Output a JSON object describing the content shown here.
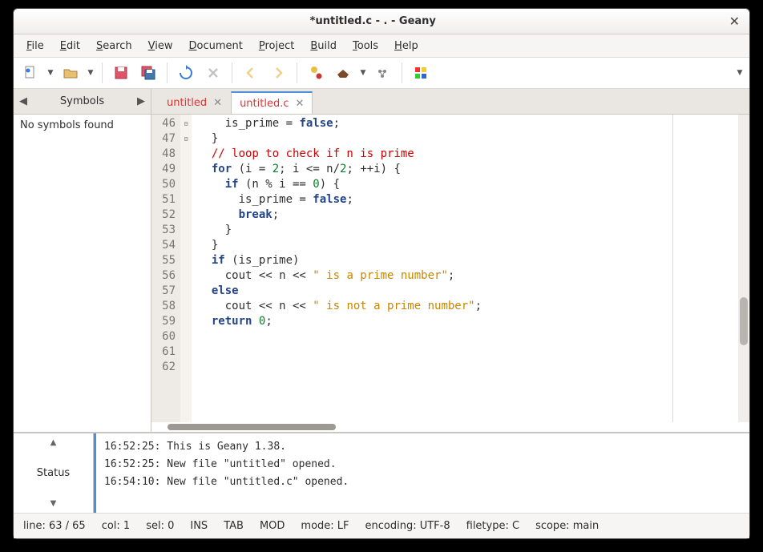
{
  "window": {
    "title": "*untitled.c - . - Geany"
  },
  "menu": [
    "File",
    "Edit",
    "Search",
    "View",
    "Document",
    "Project",
    "Build",
    "Tools",
    "Help"
  ],
  "sidebar": {
    "tab_label": "Symbols",
    "body": "No symbols found"
  },
  "tabs": [
    {
      "label": "untitled",
      "active": false
    },
    {
      "label": "untitled.c",
      "active": true
    }
  ],
  "code": {
    "first_line": 46,
    "lines": [
      {
        "n": 46,
        "fold": "",
        "tokens": [
          [
            "    is_prime = ",
            "op"
          ],
          [
            "false",
            "kw"
          ],
          [
            ";",
            "op"
          ]
        ]
      },
      {
        "n": 47,
        "fold": "",
        "tokens": [
          [
            "  }",
            "op"
          ]
        ]
      },
      {
        "n": 48,
        "fold": "",
        "tokens": [
          [
            "",
            "op"
          ]
        ]
      },
      {
        "n": 49,
        "fold": "",
        "tokens": [
          [
            "  ",
            "op"
          ],
          [
            "// loop to check if n is prime",
            "cmt"
          ]
        ]
      },
      {
        "n": 50,
        "fold": "⊟",
        "tokens": [
          [
            "  ",
            "op"
          ],
          [
            "for",
            "kw"
          ],
          [
            " (i = ",
            "op"
          ],
          [
            "2",
            "num"
          ],
          [
            "; i <= n/",
            "op"
          ],
          [
            "2",
            "num"
          ],
          [
            "; ++i) {",
            "op"
          ]
        ]
      },
      {
        "n": 51,
        "fold": "⊟",
        "tokens": [
          [
            "    ",
            "op"
          ],
          [
            "if",
            "kw"
          ],
          [
            " (n % i == ",
            "op"
          ],
          [
            "0",
            "num"
          ],
          [
            ") {",
            "op"
          ]
        ]
      },
      {
        "n": 52,
        "fold": "",
        "tokens": [
          [
            "      is_prime = ",
            "op"
          ],
          [
            "false",
            "kw"
          ],
          [
            ";",
            "op"
          ]
        ]
      },
      {
        "n": 53,
        "fold": "",
        "tokens": [
          [
            "      ",
            "op"
          ],
          [
            "break",
            "kw"
          ],
          [
            ";",
            "op"
          ]
        ]
      },
      {
        "n": 54,
        "fold": "",
        "tokens": [
          [
            "    }",
            "op"
          ]
        ]
      },
      {
        "n": 55,
        "fold": "",
        "tokens": [
          [
            "  }",
            "op"
          ]
        ]
      },
      {
        "n": 56,
        "fold": "",
        "tokens": [
          [
            "",
            "op"
          ]
        ]
      },
      {
        "n": 57,
        "fold": "",
        "tokens": [
          [
            "  ",
            "op"
          ],
          [
            "if",
            "kw"
          ],
          [
            " (is_prime)",
            "op"
          ]
        ]
      },
      {
        "n": 58,
        "fold": "",
        "tokens": [
          [
            "    cout << n << ",
            "op"
          ],
          [
            "\" is a prime number\"",
            "str"
          ],
          [
            ";",
            "op"
          ]
        ]
      },
      {
        "n": 59,
        "fold": "",
        "tokens": [
          [
            "  ",
            "op"
          ],
          [
            "else",
            "kw"
          ]
        ]
      },
      {
        "n": 60,
        "fold": "",
        "tokens": [
          [
            "    cout << n << ",
            "op"
          ],
          [
            "\" is not a prime number\"",
            "str"
          ],
          [
            ";",
            "op"
          ]
        ]
      },
      {
        "n": 61,
        "fold": "",
        "tokens": [
          [
            "",
            "op"
          ]
        ]
      },
      {
        "n": 62,
        "fold": "",
        "tokens": [
          [
            "  ",
            "op"
          ],
          [
            "return",
            "kw"
          ],
          [
            " ",
            "op"
          ],
          [
            "0",
            "num"
          ],
          [
            ";",
            "op"
          ]
        ]
      }
    ]
  },
  "messages": {
    "tab_label": "Status",
    "lines": [
      "16:52:25: This is Geany 1.38.",
      "16:52:25: New file \"untitled\" opened.",
      "16:54:10: New file \"untitled.c\" opened."
    ]
  },
  "status": {
    "line": "line: 63 / 65",
    "col": "col: 1",
    "sel": "sel: 0",
    "ins": "INS",
    "tab": "TAB",
    "mod": "MOD",
    "mode": "mode: LF",
    "encoding": "encoding: UTF-8",
    "filetype": "filetype: C",
    "scope": "scope: main"
  },
  "colors": {
    "accent": "#4a90d9"
  }
}
